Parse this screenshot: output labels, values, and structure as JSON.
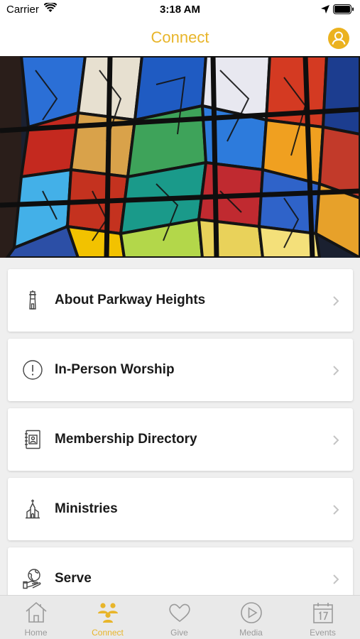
{
  "status_bar": {
    "carrier": "Carrier",
    "time": "3:18 AM"
  },
  "nav": {
    "title": "Connect",
    "accent_color": "#e8b52a"
  },
  "hero": {
    "description_icon": "stained-glass-window-image"
  },
  "menu": {
    "items": [
      {
        "label": "About Parkway Heights",
        "icon": "lighthouse-icon"
      },
      {
        "label": "In-Person Worship",
        "icon": "exclamation-circle-icon"
      },
      {
        "label": "Membership Directory",
        "icon": "directory-book-icon"
      },
      {
        "label": "Ministries",
        "icon": "church-icon"
      },
      {
        "label": "Serve",
        "icon": "globe-hand-icon"
      }
    ]
  },
  "tabs": [
    {
      "label": "Home",
      "icon": "home-icon",
      "active": false
    },
    {
      "label": "Connect",
      "icon": "people-icon",
      "active": true
    },
    {
      "label": "Give",
      "icon": "heart-icon",
      "active": false
    },
    {
      "label": "Media",
      "icon": "play-circle-icon",
      "active": false
    },
    {
      "label": "Events",
      "icon": "calendar-icon",
      "active": false
    }
  ],
  "colors": {
    "active_tab": "#e8b52a",
    "inactive_tab": "#9a9a9a"
  }
}
